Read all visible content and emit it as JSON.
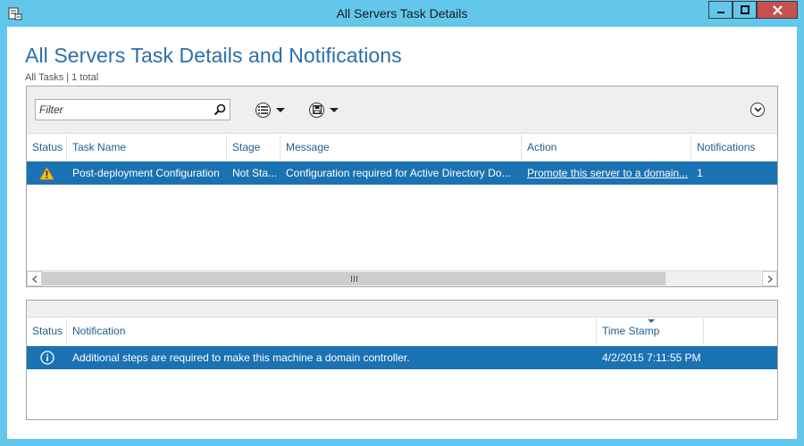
{
  "window": {
    "title": "All Servers Task Details"
  },
  "page": {
    "title": "All Servers Task Details and Notifications",
    "subtitle": "All Tasks | 1 total"
  },
  "toolbar": {
    "filter_placeholder": "Filter"
  },
  "tasks": {
    "columns": [
      "Status",
      "Task Name",
      "Stage",
      "Message",
      "Action",
      "Notifications"
    ],
    "rows": [
      {
        "status_icon": "warning-icon",
        "task_name": "Post-deployment Configuration",
        "stage": "Not Sta...",
        "message": "Configuration required for Active Directory Do...",
        "action": "Promote this server to a domain...",
        "notifications": "1"
      }
    ]
  },
  "notifications": {
    "columns": [
      "Status",
      "Notification",
      "Time Stamp"
    ],
    "sorted_column": "Time Stamp",
    "rows": [
      {
        "status_icon": "info-icon",
        "notification": "Additional steps are required to make this machine a domain controller.",
        "time_stamp": "4/2/2015 7:11:55 PM"
      }
    ]
  },
  "colors": {
    "window_chrome": "#63c7ec",
    "selection": "#1b72b3",
    "title_blue": "#2a6fa8",
    "close_button": "#c75050"
  }
}
